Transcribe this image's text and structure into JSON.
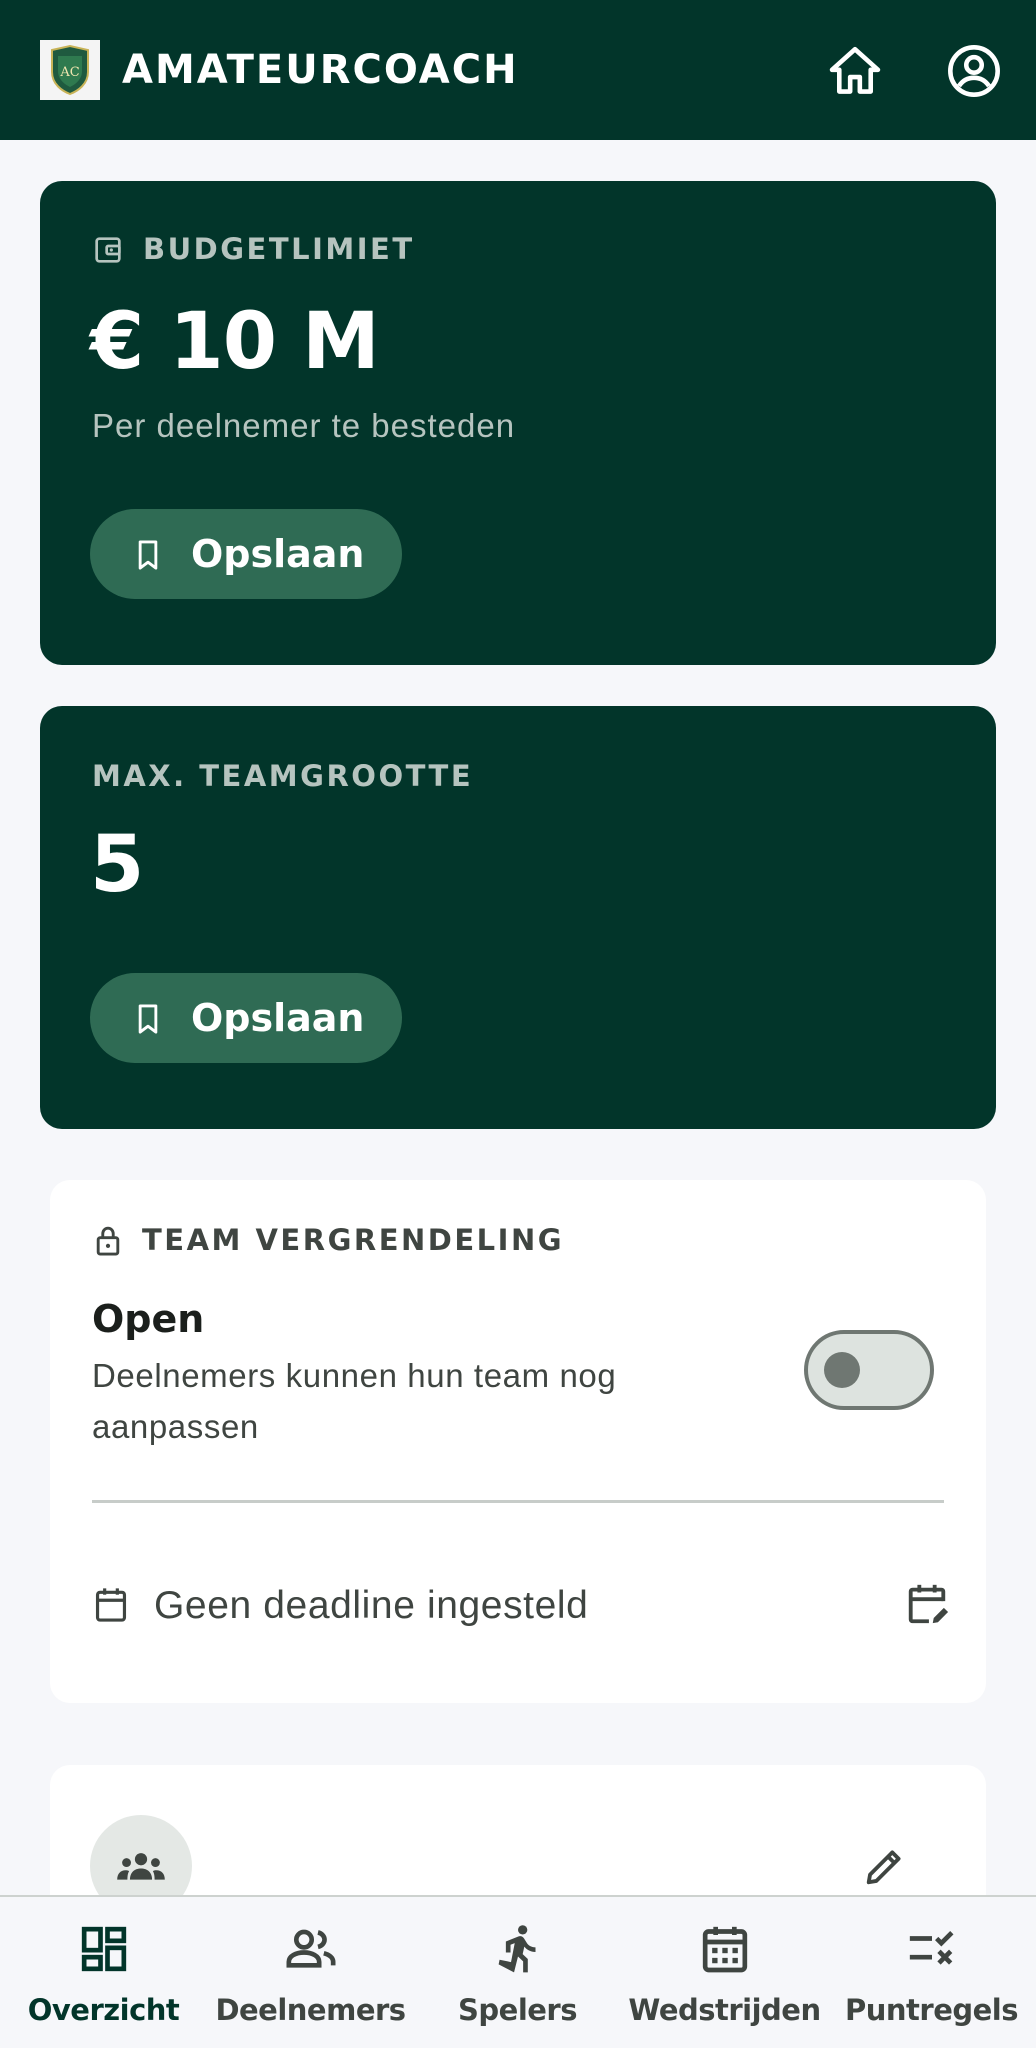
{
  "header": {
    "title": "AMATEURCOACH",
    "logo_icon": "club-crest-logo",
    "home_icon": "home-icon",
    "account_icon": "account-circle-icon",
    "background": "#02352a"
  },
  "budget_card": {
    "label": "BUDGETLIMIET",
    "icon": "wallet-icon",
    "value": "€ 10 M",
    "subtitle": "Per deelnemer te besteden",
    "save_label": "Opslaan"
  },
  "team_size_card": {
    "label": "MAX. TEAMGROOTTE",
    "value": "5",
    "save_label": "Opslaan"
  },
  "lock_card": {
    "label": "TEAM VERGRENDELING",
    "icon": "lock-icon",
    "state": "Open",
    "description": "Deelnemers kunnen hun team nog aanpassen",
    "toggle_on": false,
    "deadline_text": "Geen deadline ingesteld",
    "deadline_icon": "calendar-icon",
    "deadline_edit_icon": "calendar-edit-icon"
  },
  "participants_card": {
    "avatar_icon": "groups-icon",
    "edit_icon": "pencil-icon"
  },
  "bottom_nav": {
    "items": [
      {
        "label": "Overzicht",
        "icon": "dashboard-icon",
        "active": true
      },
      {
        "label": "Deelnemers",
        "icon": "people-icon",
        "active": false
      },
      {
        "label": "Spelers",
        "icon": "running-player-icon",
        "active": false
      },
      {
        "label": "Wedstrijden",
        "icon": "calendar-month-icon",
        "active": false
      },
      {
        "label": "Puntregels",
        "icon": "rule-icon",
        "active": false
      }
    ]
  },
  "colors": {
    "brand_dark": "#02352a",
    "button_green": "#2f6b54",
    "muted_label": "#b6c4bf",
    "background": "#f6f7fa"
  }
}
